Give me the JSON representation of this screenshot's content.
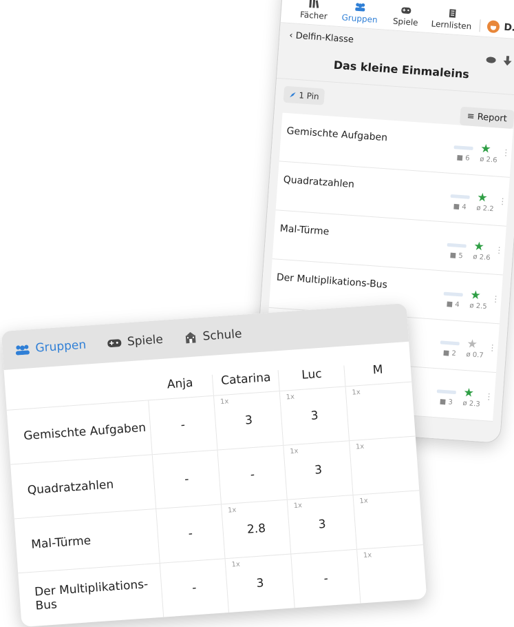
{
  "phone": {
    "tabs": [
      {
        "label": "Fächer",
        "icon": "books-icon"
      },
      {
        "label": "Gruppen",
        "icon": "group-icon"
      },
      {
        "label": "Spiele",
        "icon": "gamepad-icon"
      },
      {
        "label": "Lernlisten",
        "icon": "list-icon"
      }
    ],
    "user_label": "D…",
    "back_label": "‹ Delfin-Klasse",
    "title": "Das kleine Einmaleins",
    "pin_label": "1 Pin",
    "report_label": "≡ Report",
    "rows": [
      {
        "name": "Gemischte Aufgaben",
        "count": "6",
        "avg": "ø 2.6",
        "progress": 1.0,
        "star": "green"
      },
      {
        "name": "Quadratzahlen",
        "count": "4",
        "avg": "ø 2.2",
        "progress": 0.7,
        "star": "green"
      },
      {
        "name": "Mal-Türme",
        "count": "5",
        "avg": "ø 2.6",
        "progress": 0.85,
        "star": "green"
      },
      {
        "name": "Der Multiplikations-Bus",
        "count": "4",
        "avg": "ø 2.5",
        "progress": 0.7,
        "star": "green"
      },
      {
        "name": "",
        "count": "2",
        "avg": "ø 0.7",
        "progress": 0.35,
        "star": "gray"
      },
      {
        "name": "",
        "count": "3",
        "avg": "ø 2.3",
        "progress": 0.55,
        "star": "green"
      }
    ]
  },
  "table": {
    "nav": [
      {
        "label": "Gruppen",
        "icon": "group-icon"
      },
      {
        "label": "Spiele",
        "icon": "gamepad-icon"
      },
      {
        "label": "Schule",
        "icon": "school-icon"
      }
    ],
    "columns": [
      "Anja",
      "Catarina",
      "Luc",
      "M"
    ],
    "rows": [
      {
        "name": "Gemischte Aufgaben",
        "cells": [
          {
            "small": "",
            "value": "-"
          },
          {
            "small": "1x",
            "value": "3"
          },
          {
            "small": "1x",
            "value": "3"
          },
          {
            "small": "1x",
            "value": ""
          }
        ]
      },
      {
        "name": "Quadratzahlen",
        "cells": [
          {
            "small": "",
            "value": "-"
          },
          {
            "small": "",
            "value": "-"
          },
          {
            "small": "1x",
            "value": "3"
          },
          {
            "small": "1x",
            "value": ""
          }
        ]
      },
      {
        "name": "Mal-Türme",
        "cells": [
          {
            "small": "",
            "value": "-"
          },
          {
            "small": "1x",
            "value": "2.8"
          },
          {
            "small": "1x",
            "value": "3"
          },
          {
            "small": "1x",
            "value": ""
          }
        ]
      },
      {
        "name": "Der Multiplikations-Bus",
        "cells": [
          {
            "small": "",
            "value": "-"
          },
          {
            "small": "1x",
            "value": "3"
          },
          {
            "small": "",
            "value": "-"
          },
          {
            "small": "1x",
            "value": ""
          }
        ]
      }
    ]
  },
  "colors": {
    "accent": "#2f7fd6",
    "star_green": "#2e9e44",
    "star_gray": "#b8b8b8",
    "bar": "#4aa3f0"
  }
}
